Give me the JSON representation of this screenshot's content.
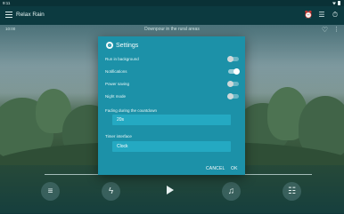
{
  "status": {
    "time": "9:11"
  },
  "app": {
    "title": "Relax Rain",
    "subtitle_left": "10:00",
    "subtitle_center": "Downpour in the rural areas"
  },
  "settings": {
    "title": "Settings",
    "options": [
      {
        "label": "Run in background",
        "on": false
      },
      {
        "label": "Notifications",
        "on": true
      },
      {
        "label": "Power saving",
        "on": false
      },
      {
        "label": "Night mode",
        "on": false
      }
    ],
    "fading_label": "Fading during the countdown",
    "fading_value": "20s",
    "timer_label": "Timer interface",
    "timer_value": "Clock",
    "cancel": "CANCEL",
    "ok": "OK"
  },
  "colors": {
    "dialog": "#1c91a8",
    "field": "#24a9c2",
    "appbar": "#0c3a40"
  },
  "icons": [
    "menu-icon",
    "alarm-icon",
    "equalizer-icon",
    "timer-icon",
    "favorite-icon",
    "more-icon",
    "playlist-icon",
    "lightning-icon",
    "play-icon",
    "music-note-icon",
    "queue-icon",
    "settings-gear-icon"
  ]
}
